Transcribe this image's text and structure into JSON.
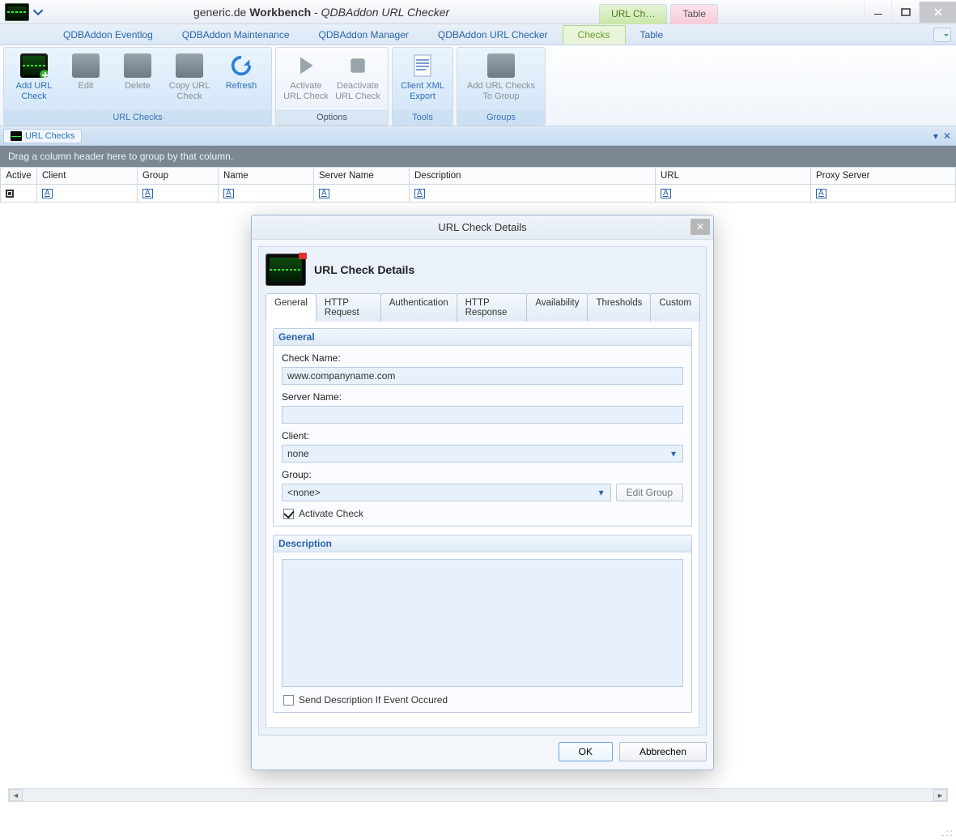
{
  "title": {
    "prefix": "generic.de ",
    "bold": "Workbench",
    "sep": " - ",
    "italic": "QDBAddon URL Checker"
  },
  "context_tabs": [
    "URL Ch…",
    "Table"
  ],
  "menu_tabs": [
    "QDBAddon Eventlog",
    "QDBAddon Maintenance",
    "QDBAddon Manager",
    "QDBAddon URL Checker",
    "Checks",
    "Table"
  ],
  "menu_active_index": 4,
  "ribbon": {
    "groups": [
      {
        "caption": "URL Checks",
        "accent": true,
        "items": [
          {
            "label": "Add URL Check",
            "icon": "screen-add"
          },
          {
            "label": "Edit",
            "icon": "screen",
            "disabled": true
          },
          {
            "label": "Delete",
            "icon": "screen",
            "disabled": true
          },
          {
            "label": "Copy URL Check",
            "icon": "screen",
            "disabled": true
          },
          {
            "label": "Refresh",
            "icon": "refresh"
          }
        ]
      },
      {
        "caption": "Options",
        "items": [
          {
            "label": "Activate URL Check",
            "icon": "play",
            "disabled": true
          },
          {
            "label": "Deactivate URL Check",
            "icon": "stop",
            "disabled": true
          }
        ]
      },
      {
        "caption": "Tools",
        "accent": true,
        "items": [
          {
            "label": "Client XML Export",
            "icon": "doc"
          }
        ]
      },
      {
        "caption": "Groups",
        "accent": true,
        "items": [
          {
            "label": "Add URL Checks To Group",
            "icon": "screen",
            "disabled": true
          }
        ]
      }
    ]
  },
  "subtab": "URL Checks",
  "groupbar_text": "Drag a column header here to group by that column.",
  "columns": [
    "Active",
    "Client",
    "Group",
    "Name",
    "Server Name",
    "Description",
    "URL",
    "Proxy Server"
  ],
  "dialog": {
    "title": "URL Check Details",
    "header": "URL Check Details",
    "tabs": [
      "General",
      "HTTP Request",
      "Authentication",
      "HTTP Response",
      "Availability",
      "Thresholds",
      "Custom"
    ],
    "active_tab": 0,
    "section_general": "General",
    "check_name_label": "Check Name:",
    "check_name_value": "www.companyname.com",
    "server_name_label": "Server Name:",
    "server_name_value": "",
    "client_label": "Client:",
    "client_value": "none",
    "group_label": "Group:",
    "group_value": "<none>",
    "edit_group_btn": "Edit Group",
    "activate_check_label": "Activate Check",
    "activate_check_checked": true,
    "section_description": "Description",
    "description_value": "",
    "send_desc_label": "Send Description If Event Occured",
    "send_desc_checked": false,
    "ok": "OK",
    "cancel": "Abbrechen"
  }
}
